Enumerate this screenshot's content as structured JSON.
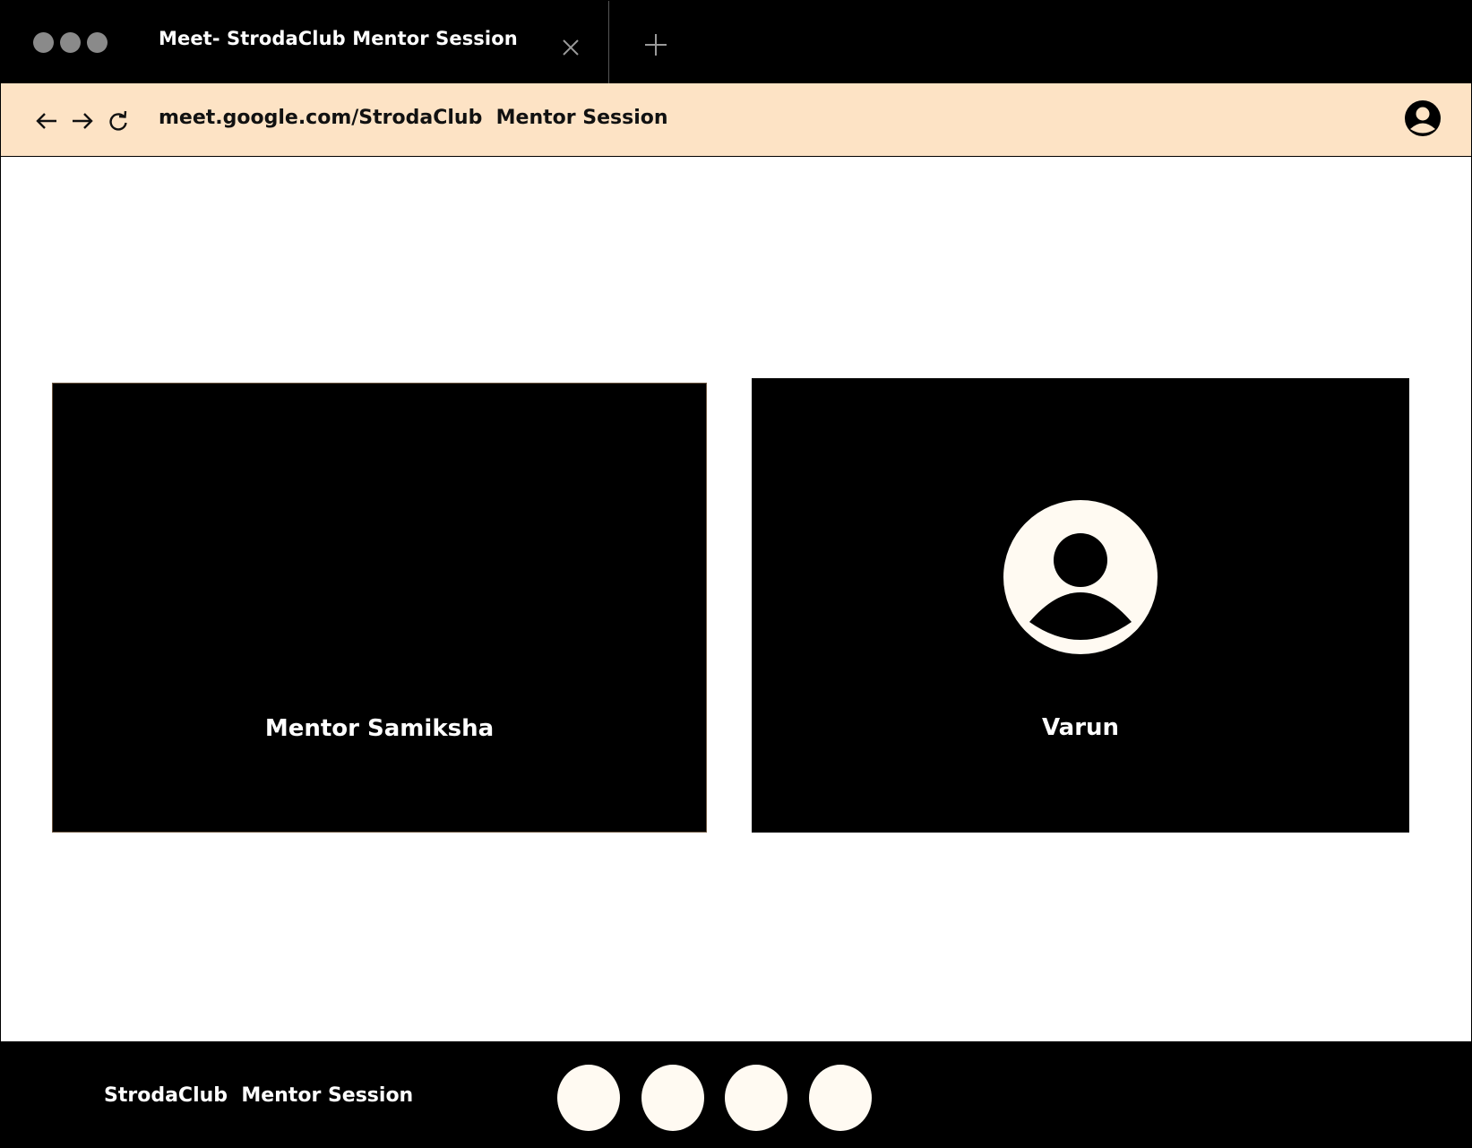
{
  "browser": {
    "tab_title": "Meet- StrodaClub Mentor Session",
    "url": "meet.google.com/StrodaClub  Mentor Session"
  },
  "participants": [
    {
      "name": "Mentor Samiksha",
      "has_avatar": false
    },
    {
      "name": "Varun",
      "has_avatar": true
    }
  ],
  "controls": {
    "meeting_name": "StrodaClub  Mentor Session",
    "buttons": [
      "control-1",
      "control-2",
      "control-3",
      "control-4"
    ]
  },
  "colors": {
    "tabbar_bg": "#000000",
    "addressbar_bg": "#fde3c5",
    "tile_bg": "#000000",
    "control_button": "#fffaf2",
    "window_dots": "#8a8a8a"
  },
  "icons": [
    "back-arrow-icon",
    "forward-arrow-icon",
    "reload-icon",
    "profile-icon",
    "close-icon",
    "plus-icon",
    "avatar-icon"
  ]
}
